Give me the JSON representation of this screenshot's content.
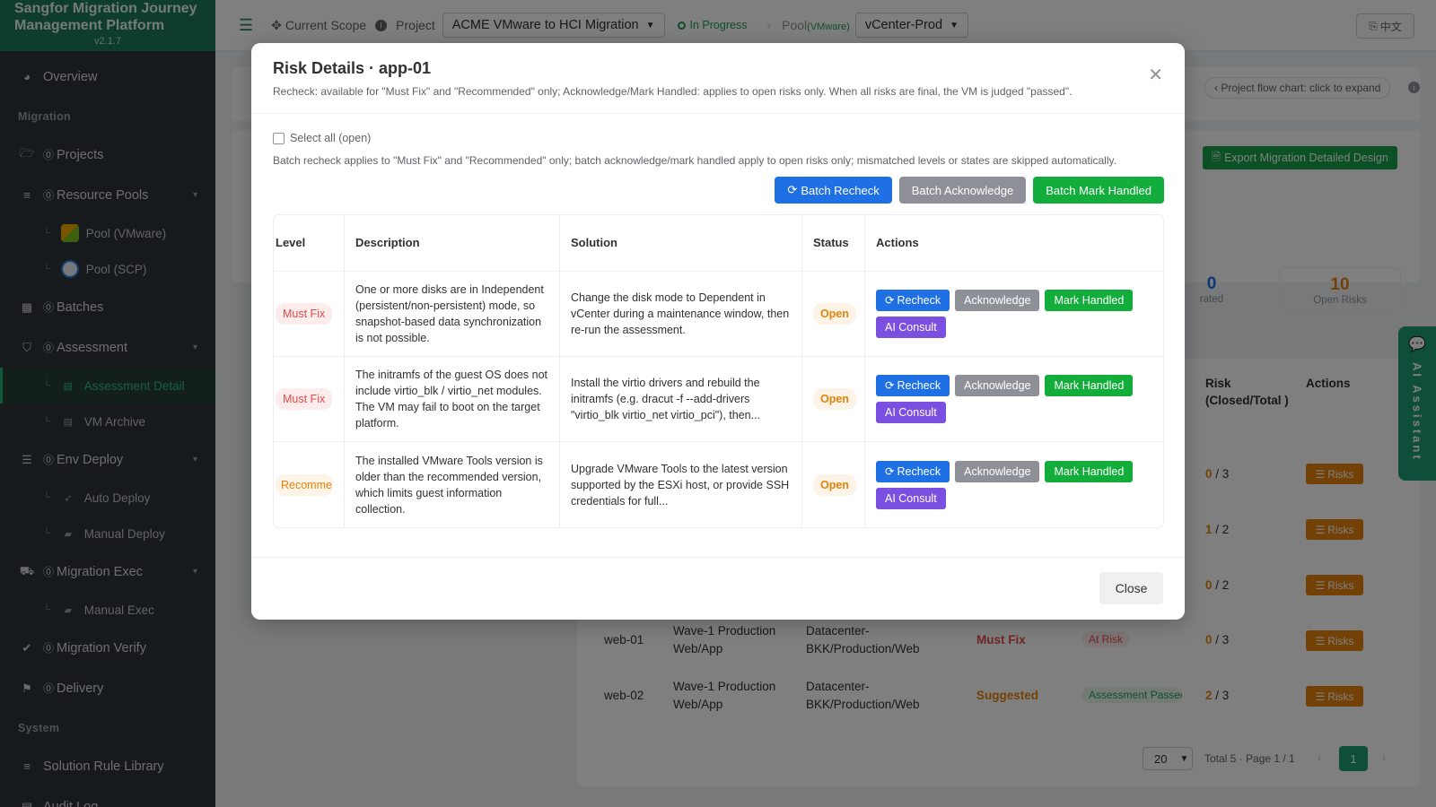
{
  "app": {
    "title_line1": "Sangfor Migration Journey",
    "title_line2": "Management Platform",
    "version": "v2.1.7"
  },
  "sidebar": {
    "overview": "Overview",
    "section_migration": "Migration",
    "projects": "Projects",
    "resource_pools": "Resource Pools",
    "pool_vmware": "Pool (VMware)",
    "pool_scp": "Pool (SCP)",
    "batches": "Batches",
    "assessment": "Assessment",
    "assessment_detail": "Assessment Detail",
    "vm_archive": "VM Archive",
    "env_deploy": "Env Deploy",
    "auto_deploy": "Auto Deploy",
    "manual_deploy": "Manual Deploy",
    "migration_exec": "Migration Exec",
    "manual_exec": "Manual Exec",
    "migration_verify": "Migration Verify",
    "delivery": "Delivery",
    "section_system": "System",
    "solution_rule_library": "Solution Rule Library",
    "audit_log": "Audit Log"
  },
  "topbar": {
    "current_scope": "Current Scope",
    "project_label": "Project",
    "project_value": "ACME VMware to HCI Migration",
    "status": "In Progress",
    "pool_label": "Pool",
    "pool_type": "(VMware)",
    "pool_value": "vCenter-Prod",
    "lang": "中文"
  },
  "background": {
    "flow_chart": "‹ Project flow chart: click to expand",
    "export_btn": "Export Migration Detailed Design",
    "stat_value": "10",
    "stat_label": "Open Risks",
    "partial_stat_value": "0",
    "partial_stat_label": "rated",
    "col_risk": "Risk (Closed/Total )",
    "col_actions": "Actions",
    "risks_btn": "Risks",
    "rows": [
      {
        "closed": "0",
        "total": "/ 3"
      },
      {
        "closed": "1",
        "total": "/ 2"
      },
      {
        "closed": "0",
        "total": "/ 2"
      },
      {
        "vm": "web-01",
        "batch": "Wave-1 Production Web/App",
        "path": "Datacenter-BKK/Production/Web",
        "level": "Must Fix",
        "state": "At Risk",
        "closed": "0",
        "total": "/ 3"
      },
      {
        "vm": "web-02",
        "batch": "Wave-1 Production Web/App",
        "path": "Datacenter-BKK/Production/Web",
        "level": "Suggested",
        "state": "Assessment Passed",
        "closed": "2",
        "total": "/ 3"
      }
    ],
    "pager_size": "20",
    "pager_total": "Total 5 · Page 1 / 1",
    "pager_page": "1",
    "ai_assistant": "AI Assistant"
  },
  "modal": {
    "title": "Risk Details · app-01",
    "subtitle": "Recheck: available for \"Must Fix\" and \"Recommended\" only; Acknowledge/Mark Handled: applies to open risks only. When all risks are final, the VM is judged \"passed\".",
    "select_all": "Select all (open)",
    "batch_note": "Batch recheck applies to \"Must Fix\" and \"Recommended\" only; batch acknowledge/mark handled apply to open risks only; mismatched levels or states are skipped automatically.",
    "batch_recheck": "Batch Recheck",
    "batch_acknowledge": "Batch Acknowledge",
    "batch_mark_handled": "Batch Mark Handled",
    "columns": {
      "level": "Level",
      "description": "Description",
      "solution": "Solution",
      "status": "Status",
      "actions": "Actions"
    },
    "actions": {
      "recheck": "Recheck",
      "acknowledge": "Acknowledge",
      "mark_handled": "Mark Handled",
      "ai_consult": "AI Consult"
    },
    "risks": [
      {
        "level": "Must Fix",
        "description": "One or more disks are in Independent (persistent/non-persistent) mode, so snapshot-based data synchronization is not possible.",
        "solution": "Change the disk mode to Dependent in vCenter during a maintenance window, then re-run the assessment.",
        "status": "Open"
      },
      {
        "level": "Must Fix",
        "description": "The initramfs of the guest OS does not include virtio_blk / virtio_net modules. The VM may fail to boot on the target platform.",
        "solution": "Install the virtio drivers and rebuild the initramfs (e.g. dracut -f --add-drivers \"virtio_blk virtio_net virtio_pci\"), then...",
        "status": "Open"
      },
      {
        "level": "Recomme",
        "description": "The installed VMware Tools version is older than the recommended version, which limits guest information collection.",
        "solution": "Upgrade VMware Tools to the latest version supported by the ESXi host, or provide SSH credentials for full...",
        "status": "Open"
      }
    ],
    "close": "Close"
  },
  "colors": {
    "brand": "#1f7a5a",
    "primary": "#1f6fe5",
    "success": "#13ad3c",
    "warning": "#e6820a",
    "danger": "#e04b4b",
    "ai": "#7b4fe0"
  }
}
